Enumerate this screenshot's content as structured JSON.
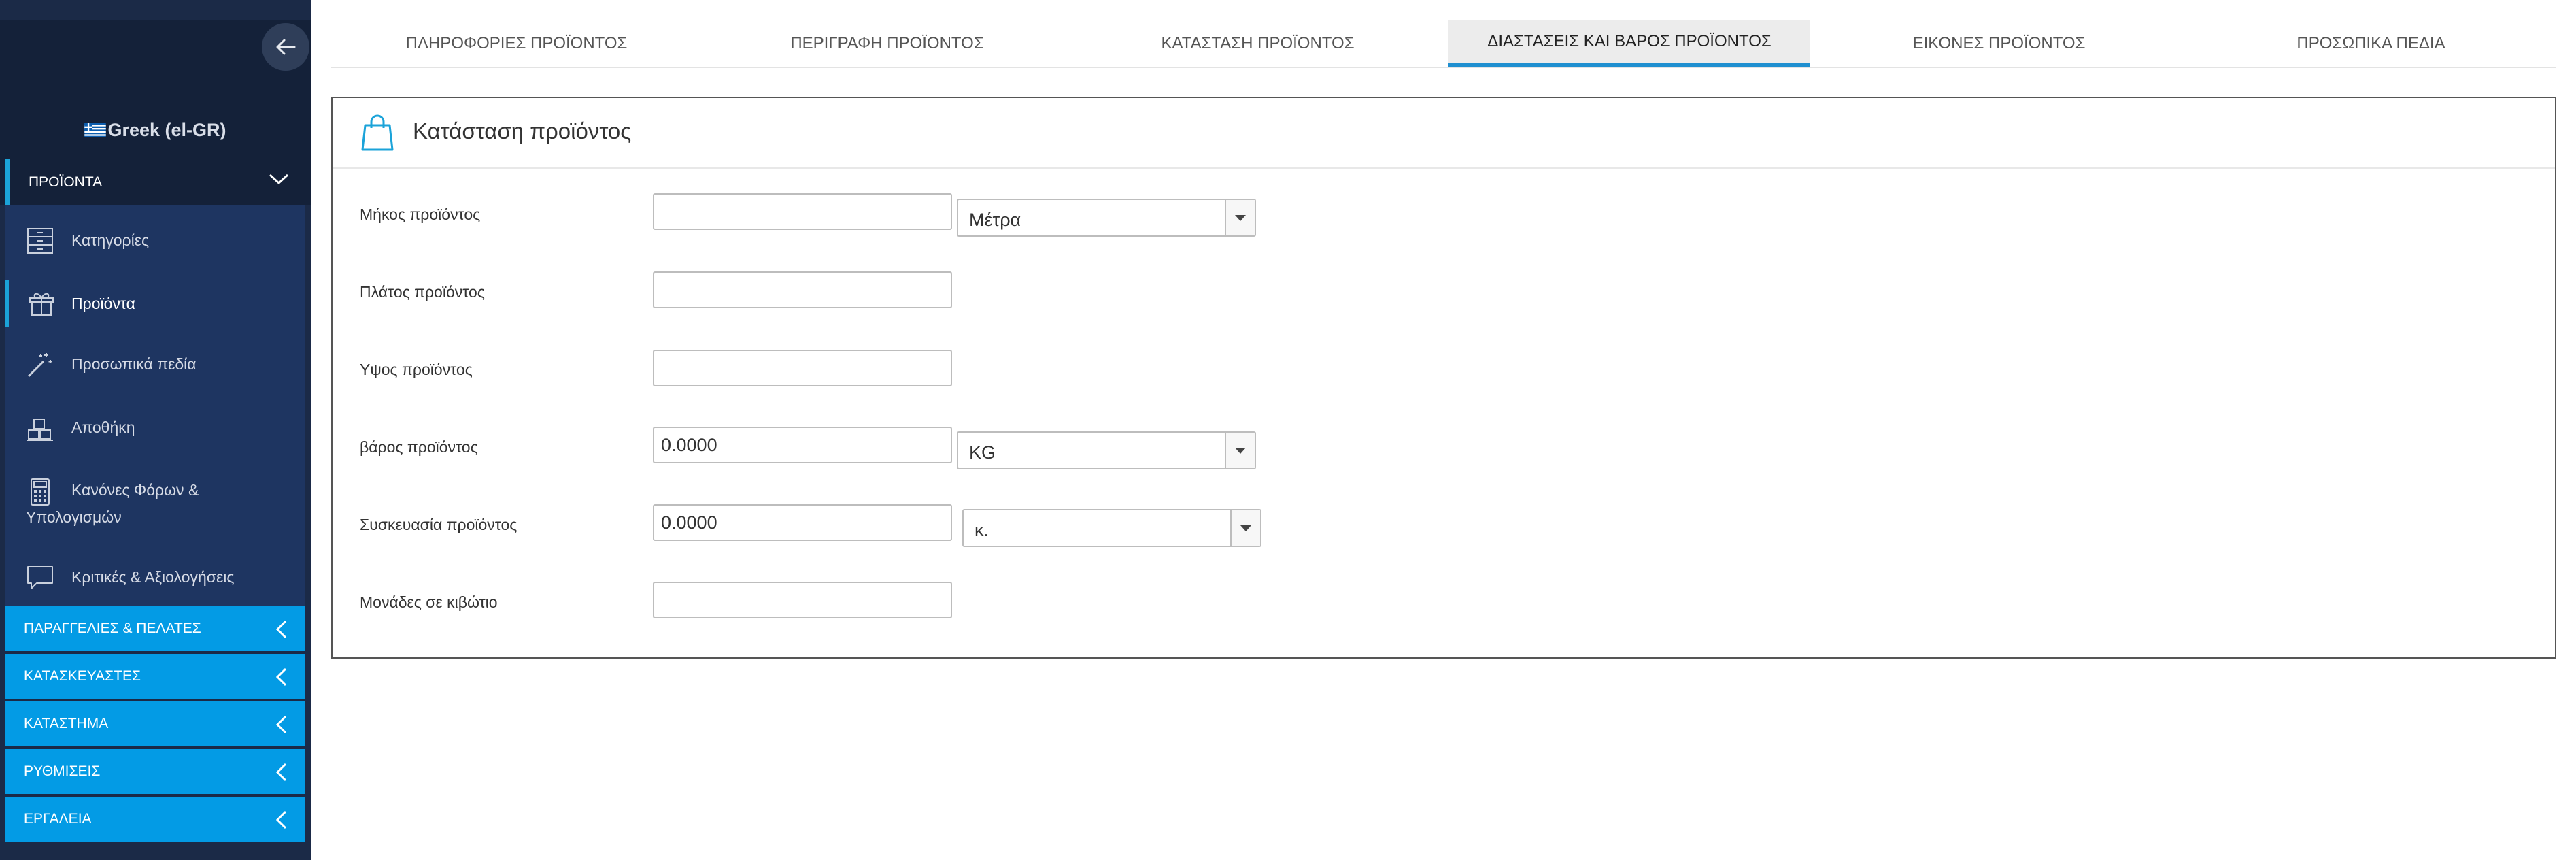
{
  "sidebar": {
    "language": "Greek (el-GR)",
    "section_products": "ΠΡΟΪΟΝΤΑ",
    "items": [
      {
        "label": "Κατηγορίες",
        "icon": "cabinet-icon"
      },
      {
        "label": "Προϊόντα",
        "icon": "gift-icon"
      },
      {
        "label": "Προσωπικά πεδία",
        "icon": "wand-icon"
      },
      {
        "label": "Αποθήκη",
        "icon": "boxes-icon"
      },
      {
        "label": "Κανόνες Φόρων & Υπολογισμών",
        "icon": "calculator-icon"
      },
      {
        "label": "Κριτικές & Αξιολογήσεις",
        "icon": "comment-icon"
      }
    ],
    "groups": [
      "ΠΑΡΑΓΓΕΛΙΕΣ & ΠΕΛΑΤΕΣ",
      "ΚΑΤΑΣΚΕΥΑΣΤΕΣ",
      "ΚΑΤΑΣΤΗΜΑ",
      "ΡΥΘΜΙΣΕΙΣ",
      "ΕΡΓΑΛΕΙΑ"
    ]
  },
  "tabs": [
    "ΠΛΗΡΟΦΟΡΙΕΣ ΠΡΟΪΟΝΤΟΣ",
    "ΠΕΡΙΓΡΑΦΗ ΠΡΟΪΟΝΤΟΣ",
    "ΚΑΤΑΣΤΑΣΗ ΠΡΟΪΟΝΤΟΣ",
    "ΔΙΑΣΤΑΣΕΙΣ ΚΑΙ ΒΑΡΟΣ ΠΡΟΪΟΝΤΟΣ",
    "ΕΙΚΟΝΕΣ ΠΡΟΪΟΝΤΟΣ",
    "ΠΡΟΣΩΠΙΚΑ ΠΕΔΙΑ"
  ],
  "active_tab": "ΔΙΑΣΤΑΣΕΙΣ ΚΑΙ ΒΑΡΟΣ ΠΡΟΪΟΝΤΟΣ",
  "panel": {
    "title": "Κατάσταση προϊόντος",
    "fields": {
      "length": {
        "label": "Μήκος προϊόντος",
        "value": "",
        "unit": "Μέτρα"
      },
      "width": {
        "label": "Πλάτος προϊόντος",
        "value": ""
      },
      "height": {
        "label": "Υψος προϊόντος",
        "value": ""
      },
      "weight": {
        "label": "βάρος προϊόντος",
        "value": "0.0000",
        "unit": "KG"
      },
      "packaging": {
        "label": "Συσκευασία προϊόντος",
        "value": "0.0000",
        "unit": "κ."
      },
      "units_per_box": {
        "label": "Μονάδες σε κιβώτιο",
        "value": ""
      }
    }
  },
  "colors": {
    "sidebar_bg": "#1b2a47",
    "submenu_bg": "#1e3561",
    "group_blue": "#039be5",
    "accent": "#1ba3d9",
    "active_tab_underline": "#1f8fd0"
  }
}
